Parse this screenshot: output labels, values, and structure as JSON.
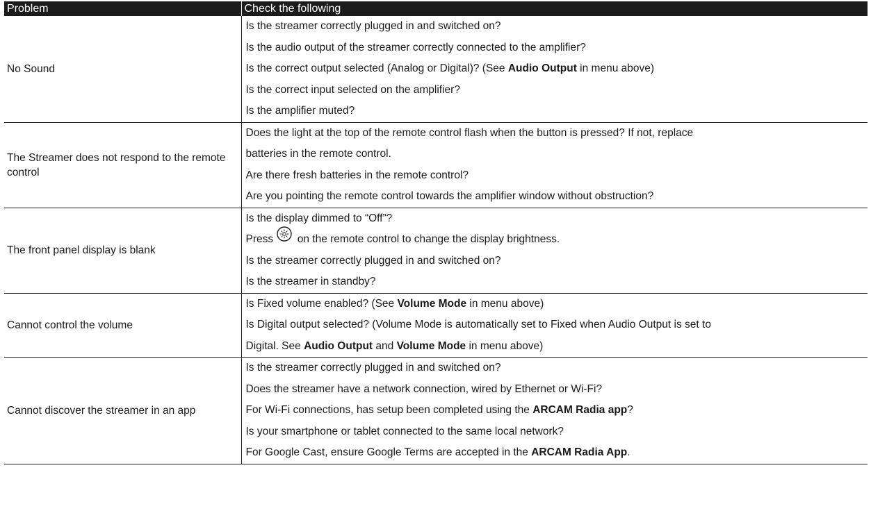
{
  "header": {
    "problem": "Problem",
    "check": "Check the following"
  },
  "rows": [
    {
      "problem": "No Sound",
      "lines": [
        [
          {
            "t": "Is the streamer correctly plugged in and switched on?"
          }
        ],
        [
          {
            "t": "Is the audio output of the streamer correctly connected to the amplifier?"
          }
        ],
        [
          {
            "t": "Is the correct output selected (Analog or Digital)? (See "
          },
          {
            "t": "Audio Output",
            "b": true
          },
          {
            "t": " in menu above)"
          }
        ],
        [
          {
            "t": "Is the correct input selected on the amplifier?"
          }
        ],
        [
          {
            "t": "Is the amplifier muted?"
          }
        ]
      ]
    },
    {
      "problem": "The Streamer does not respond to the remote control",
      "lines": [
        [
          {
            "t": "Does the light at the top of the remote control flash when the button is pressed? If not, replace"
          }
        ],
        [
          {
            "t": "batteries in the remote control."
          }
        ],
        [
          {
            "t": "Are there fresh batteries in the remote control?"
          }
        ],
        [
          {
            "t": "Are you pointing the remote control towards the amplifier window without obstruction?"
          }
        ]
      ]
    },
    {
      "problem": "The front panel display is blank",
      "lines": [
        [
          {
            "t": "Is the display dimmed to “Off”?"
          }
        ],
        [
          {
            "t": "Press "
          },
          {
            "icon": "brightness-icon"
          },
          {
            "t": " on the remote control to change the display brightness."
          }
        ],
        [
          {
            "t": "Is the streamer correctly plugged in and switched on?"
          }
        ],
        [
          {
            "t": "Is the streamer in standby?"
          }
        ]
      ]
    },
    {
      "problem": "Cannot control the volume",
      "lines": [
        [
          {
            "t": "Is Fixed volume enabled? (See "
          },
          {
            "t": "Volume Mode",
            "b": true
          },
          {
            "t": " in menu above)"
          }
        ],
        [
          {
            "t": "Is Digital output selected? (Volume Mode is automatically set to Fixed when Audio Output is set to"
          }
        ],
        [
          {
            "t": "Digital. See "
          },
          {
            "t": "Audio Output",
            "b": true
          },
          {
            "t": " and "
          },
          {
            "t": "Volume Mode",
            "b": true
          },
          {
            "t": " in menu above)"
          }
        ]
      ]
    },
    {
      "problem": "Cannot discover the streamer in an app",
      "lines": [
        [
          {
            "t": "Is the streamer correctly plugged in and switched on?"
          }
        ],
        [
          {
            "t": "Does the streamer have a network connection, wired by Ethernet or Wi-Fi?"
          }
        ],
        [
          {
            "t": "For Wi-Fi connections, has setup been completed using the "
          },
          {
            "t": "ARCAM Radia app",
            "b": true
          },
          {
            "t": "?"
          }
        ],
        [
          {
            "t": "Is your smartphone or tablet connected to the same local network?"
          }
        ],
        [
          {
            "t": "For Google Cast, ensure Google Terms are accepted in the "
          },
          {
            "t": "ARCAM Radia App",
            "b": true
          },
          {
            "t": "."
          }
        ]
      ]
    }
  ]
}
